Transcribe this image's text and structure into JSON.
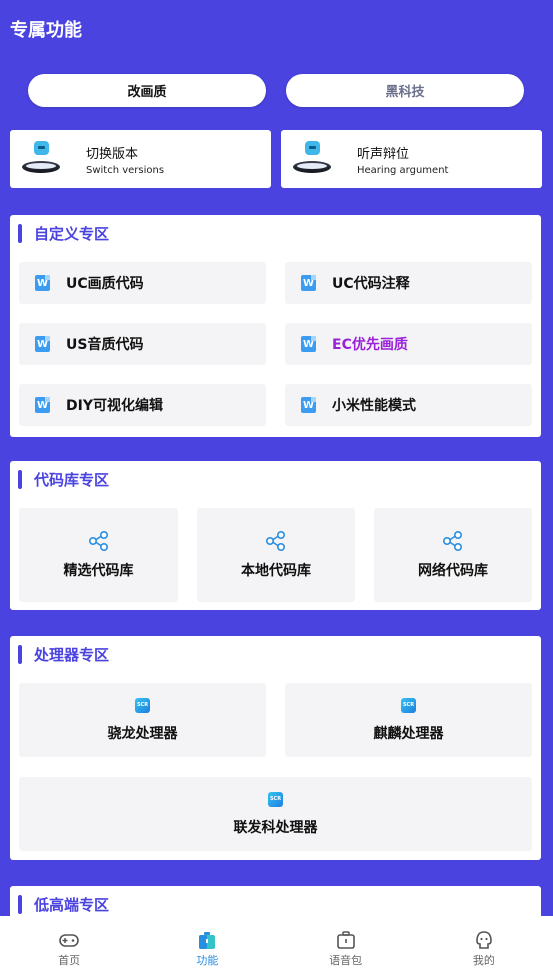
{
  "header": {
    "title": "专属功能"
  },
  "top_tabs": [
    {
      "label": "改画质",
      "selected": true
    },
    {
      "label": "黑科技",
      "selected": false
    }
  ],
  "feature_cards": [
    {
      "title": "切换版本",
      "subtitle": "Switch versions",
      "icon": "robot-pedestal-icon"
    },
    {
      "title": "听声辩位",
      "subtitle": "Hearing argument",
      "icon": "robot-pedestal-icon"
    }
  ],
  "sections": {
    "custom": {
      "title": "自定义专区",
      "items": [
        {
          "label": "UC画质代码"
        },
        {
          "label": "UC代码注释"
        },
        {
          "label": "US音质代码"
        },
        {
          "label": "EC优先画质"
        },
        {
          "label": "DIY可视化编辑"
        },
        {
          "label": "小米性能模式"
        }
      ]
    },
    "code_library": {
      "title": "代码库专区",
      "items": [
        {
          "label": "精选代码库"
        },
        {
          "label": "本地代码库"
        },
        {
          "label": "网络代码库"
        }
      ]
    },
    "processor": {
      "title": "处理器专区",
      "items": [
        {
          "label": "骁龙处理器"
        },
        {
          "label": "麒麟处理器"
        },
        {
          "label": "联发科处理器"
        }
      ]
    },
    "low_high": {
      "title": "低高端专区"
    }
  },
  "bottom_nav": [
    {
      "label": "首页",
      "icon": "gamepad-icon",
      "active": false
    },
    {
      "label": "功能",
      "icon": "briefcase-icon",
      "active": true
    },
    {
      "label": "语音包",
      "icon": "bag-icon",
      "active": false
    },
    {
      "label": "我的",
      "icon": "face-icon",
      "active": false
    }
  ],
  "colors": {
    "background": "#4a43e0",
    "accent_text": "#9a22d8",
    "nav_active": "#2a8ee0"
  }
}
